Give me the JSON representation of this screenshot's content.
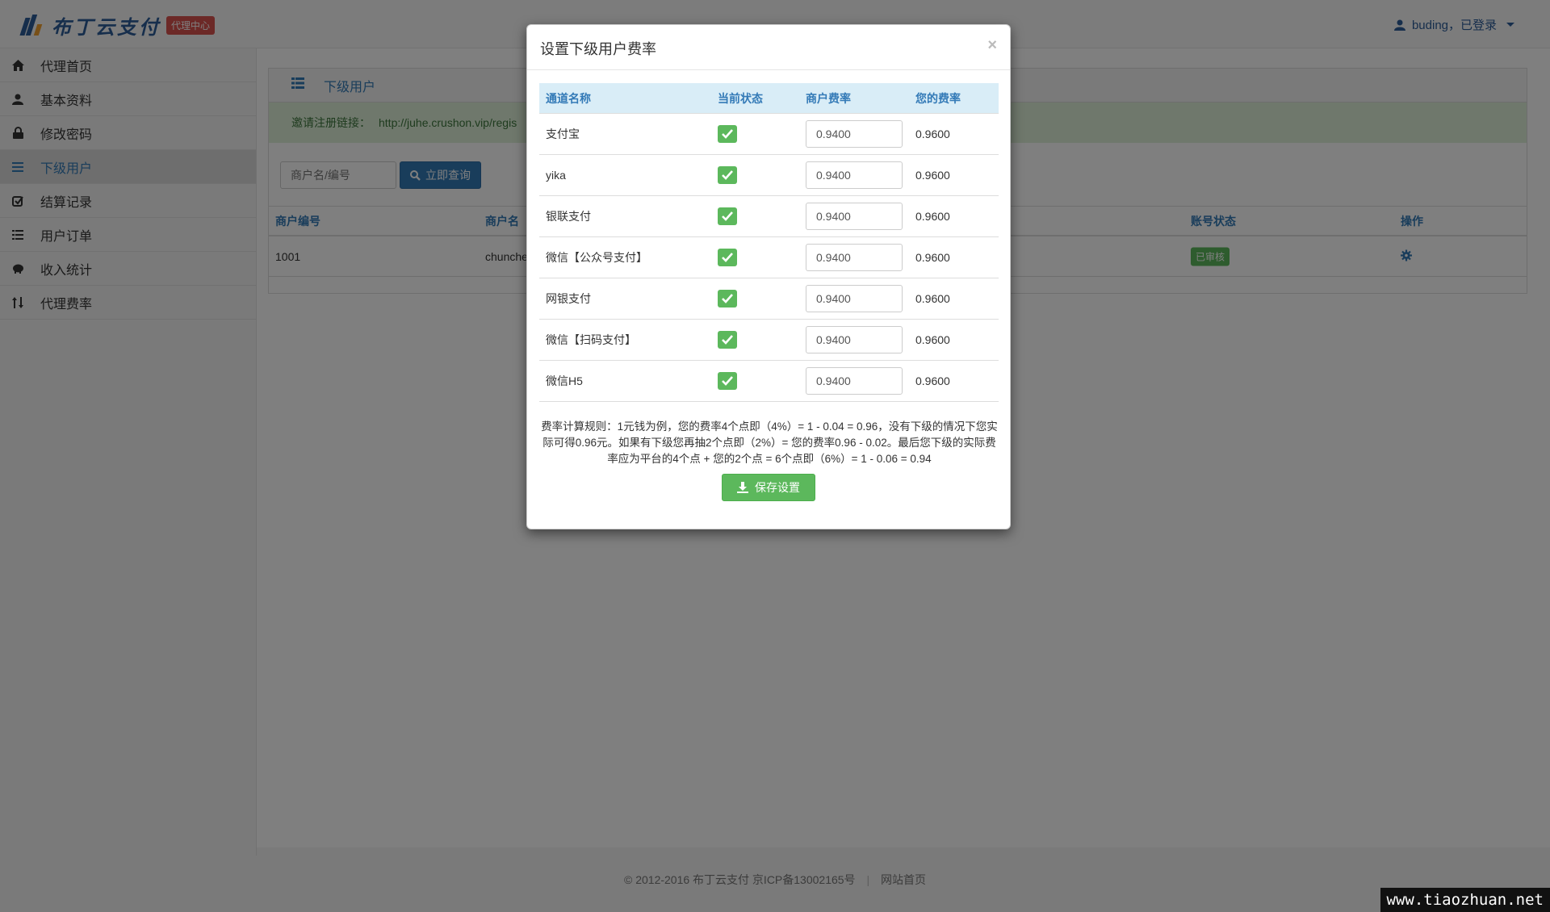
{
  "brand": {
    "name": "布丁云支付",
    "badge": "代理中心"
  },
  "user_menu": {
    "label": "buding，已登录"
  },
  "sidebar": {
    "items": [
      {
        "label": "代理首页",
        "icon": "home-icon"
      },
      {
        "label": "基本资料",
        "icon": "user-icon"
      },
      {
        "label": "修改密码",
        "icon": "lock-icon"
      },
      {
        "label": "下级用户",
        "icon": "list-icon"
      },
      {
        "label": "结算记录",
        "icon": "check-icon"
      },
      {
        "label": "用户订单",
        "icon": "list-icon"
      },
      {
        "label": "收入统计",
        "icon": "piggy-bank-icon"
      },
      {
        "label": "代理费率",
        "icon": "sort-icon"
      }
    ]
  },
  "main": {
    "panel_title": "下级用户",
    "invite_label": "邀请注册链接：",
    "invite_link": "http://juhe.crushon.vip/regis",
    "search": {
      "placeholder": "商户名/编号",
      "button": "立即查询"
    },
    "table": {
      "headers": {
        "id": "商户编号",
        "name": "商户名",
        "status": "账号状态",
        "ops": "操作"
      },
      "rows": [
        {
          "id": "1001",
          "name": "chunche",
          "status": "已审核"
        }
      ]
    }
  },
  "footer": {
    "copyright": "© 2012-2016  布丁云支付  京ICP备13002165号",
    "home_link": "网站首页"
  },
  "modal": {
    "title": "设置下级用户费率",
    "close": "×",
    "headers": {
      "channel": "通道名称",
      "state": "当前状态",
      "merchant_rate": "商户费率",
      "your_rate": "您的费率"
    },
    "rows": [
      {
        "channel": "支付宝",
        "enabled": true,
        "merchant_rate": "0.9400",
        "your_rate": "0.9600"
      },
      {
        "channel": "yika",
        "enabled": true,
        "merchant_rate": "0.9400",
        "your_rate": "0.9600"
      },
      {
        "channel": "银联支付",
        "enabled": true,
        "merchant_rate": "0.9400",
        "your_rate": "0.9600"
      },
      {
        "channel": "微信【公众号支付】",
        "enabled": true,
        "merchant_rate": "0.9400",
        "your_rate": "0.9600"
      },
      {
        "channel": "网银支付",
        "enabled": true,
        "merchant_rate": "0.9400",
        "your_rate": "0.9600"
      },
      {
        "channel": "微信【扫码支付】",
        "enabled": true,
        "merchant_rate": "0.9400",
        "your_rate": "0.9600"
      },
      {
        "channel": "微信H5",
        "enabled": true,
        "merchant_rate": "0.9400",
        "your_rate": "0.9600"
      }
    ],
    "rule_text": "费率计算规则：1元钱为例，您的费率4个点即（4%）= 1 - 0.04 = 0.96，没有下级的情况下您实际可得0.96元。如果有下级您再抽2个点即（2%）= 您的费率0.96 - 0.02。最后您下级的实际费率应为平台的4个点 + 您的2个点 = 6个点即（6%）= 1 - 0.06 = 0.94",
    "save_button": "保存设置"
  },
  "watermark": "www.tiaozhuan.net",
  "colors": {
    "primary": "#337ab7",
    "success": "#5cb85c",
    "danger": "#d9534f",
    "overlay": "rgba(0,0,0,0.5)"
  }
}
